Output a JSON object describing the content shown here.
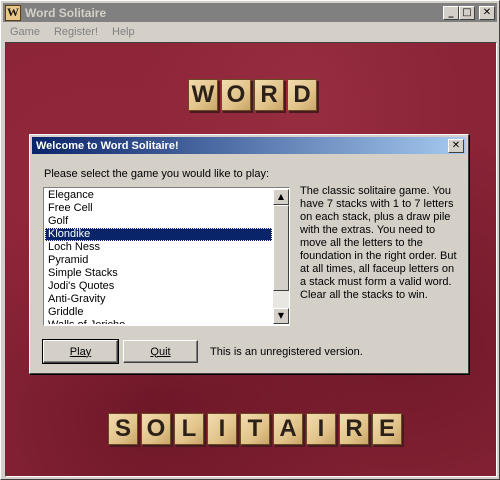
{
  "window": {
    "app_icon_letter": "W",
    "title": "Word Solitaire",
    "controls": {
      "minimize": "_",
      "maximize": "□",
      "close": "✕"
    }
  },
  "menu": {
    "items": [
      "Game",
      "Register!",
      "Help"
    ]
  },
  "board": {
    "top_word": [
      "W",
      "O",
      "R",
      "D"
    ],
    "bottom_word": [
      "S",
      "O",
      "L",
      "I",
      "T",
      "A",
      "I",
      "R",
      "E"
    ]
  },
  "dialog": {
    "title": "Welcome to Word Solitaire!",
    "close": "✕",
    "prompt": "Please select the game you would like to play:",
    "games": [
      "Elegance",
      "Free Cell",
      "Golf",
      "Klondike",
      "Loch Ness",
      "Pyramid",
      "Simple Stacks",
      "Jodi's Quotes",
      "Anti-Gravity",
      "Griddle",
      "Walls of Jericho"
    ],
    "selected_game": "Klondike",
    "scroll_up": "▲",
    "scroll_down": "▼",
    "description": "The classic solitaire game. You have 7 stacks with 1 to 7 letters on each stack, plus a draw pile with the extras. You need to move all the letters to the foundation in the right order. But at all times, all faceup letters on a stack must form a valid word. Clear all the stacks to win.",
    "play_label": "Play",
    "quit_label": "Quit",
    "status": "This is an unregistered version."
  },
  "colors": {
    "felt": "#8a2437",
    "tile": "#e1c38a",
    "dialog_title": "#0a246a",
    "selection": "#0a246a"
  }
}
